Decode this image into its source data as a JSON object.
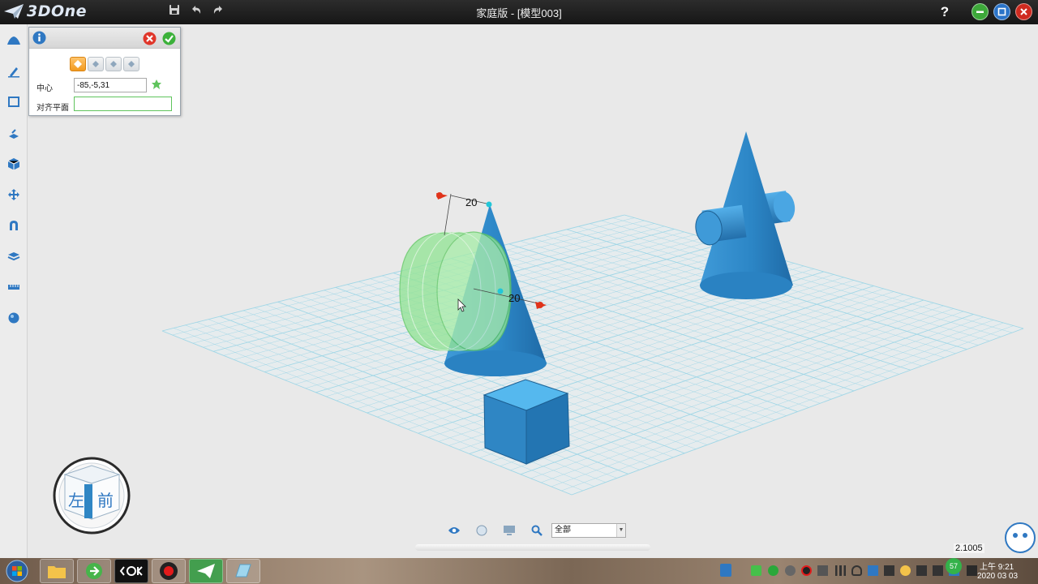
{
  "app": {
    "name": "3DOne",
    "window_title": "家庭版 - [模型003]"
  },
  "titlebar": {
    "help": "?"
  },
  "panel": {
    "center_label": "中心",
    "center_value": "-85,-5,31",
    "align_label": "对齐平面",
    "align_value": ""
  },
  "viewport": {
    "dim_labels": [
      "20",
      "20"
    ],
    "view_cube": {
      "left_face": "左",
      "front_face": "前"
    },
    "coord_readout": "2.1005"
  },
  "bottombar": {
    "filter_value": "全部"
  },
  "taskbar": {
    "clock_time": "上午 9:21",
    "clock_date": "2020 03 03",
    "badge": "57"
  },
  "colors": {
    "accent": "#1f7fc4",
    "shape_blue": "#2f8fd0",
    "preview_green": "#8fe28c",
    "grid_line": "#9fd6e6",
    "dimension_red": "#e0331a"
  }
}
